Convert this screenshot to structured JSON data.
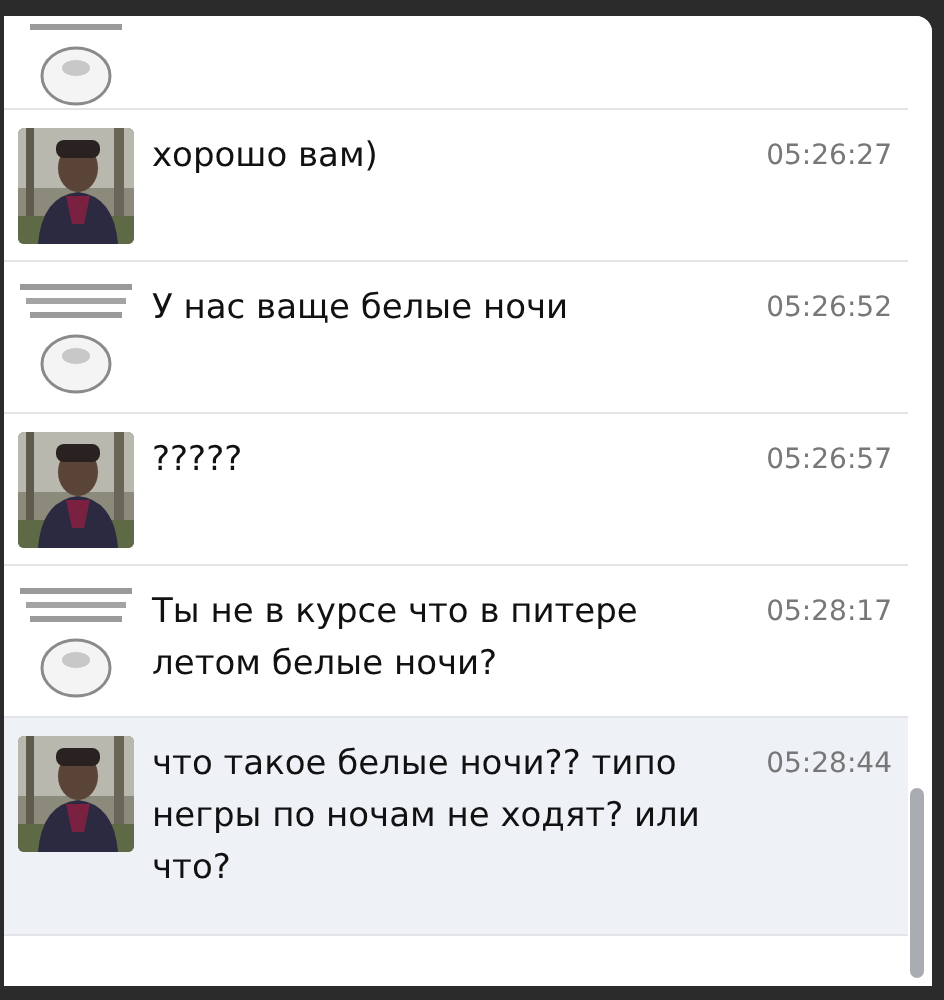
{
  "messages": [
    {
      "kind": "meme",
      "partial": true,
      "selected": false
    },
    {
      "text": "хорошо вам)",
      "time": "05:26:27",
      "selected": false
    },
    {
      "kind": "meme",
      "text": "У нас ваще белые ночи",
      "time": "05:26:52",
      "selected": false
    },
    {
      "text": "?????",
      "time": "05:26:57",
      "selected": false
    },
    {
      "kind": "meme",
      "text": "Ты не в курсе что в питере летом белые ночи?",
      "time": "05:28:17",
      "selected": false
    },
    {
      "text": "что такое белые ночи?? типо негры по ночам не ходят? или что?",
      "time": "05:28:44",
      "selected": true
    }
  ]
}
